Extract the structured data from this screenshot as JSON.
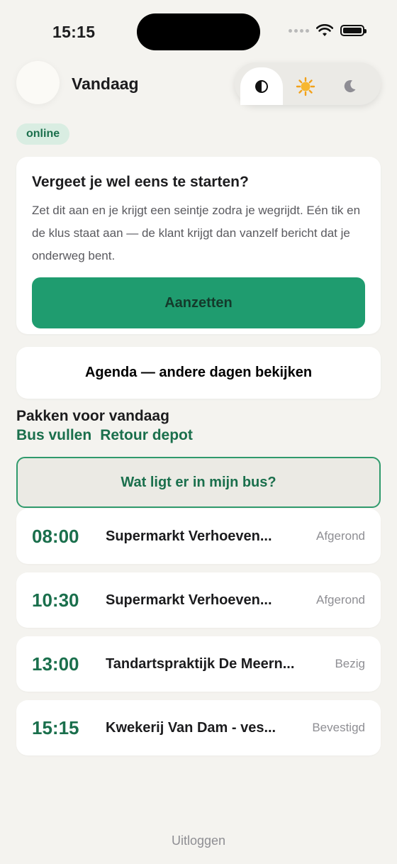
{
  "status_bar": {
    "time": "15:15"
  },
  "header": {
    "title": "Vandaag"
  },
  "theme_switch": {
    "options": [
      {
        "name": "auto",
        "icon": "contrast-icon",
        "glyph": "◐",
        "active": true
      },
      {
        "name": "light",
        "icon": "sun-icon",
        "glyph": "☀",
        "active": false
      },
      {
        "name": "dark",
        "icon": "moon-icon",
        "glyph": "☾",
        "active": false
      }
    ]
  },
  "connection": {
    "status": "online"
  },
  "start_card": {
    "title": "Vergeet je wel eens te starten?",
    "body": "Zet dit aan en je krijgt een seintje zodra je wegrijdt. Eén tik en de klus staat aan — de klant krijgt dan vanzelf bericht dat je onderweg bent.",
    "button_label": "Aanzetten"
  },
  "agenda": {
    "label": "Agenda — andere dagen bekijken"
  },
  "packing": {
    "title": "Pakken voor vandaag",
    "links": [
      "Bus vullen",
      "Retour depot"
    ],
    "bus_button_label": "Wat ligt er in mijn bus?"
  },
  "jobs": [
    {
      "time": "08:00",
      "name": "Supermarkt Verhoeven...",
      "status": "Afgerond"
    },
    {
      "time": "10:30",
      "name": "Supermarkt Verhoeven...",
      "status": "Afgerond"
    },
    {
      "time": "13:00",
      "name": "Tandartspraktijk De Meern...",
      "status": "Bezig"
    },
    {
      "time": "15:15",
      "name": "Kwekerij Van Dam - ves...",
      "status": "Bevestigd"
    }
  ],
  "footer": {
    "logout_label": "Uitloggen"
  },
  "colors": {
    "background": "#f4f3ef",
    "accent": "#1f9c6f",
    "accent_text": "#1a6f4c",
    "badge_bg": "#d9ede2",
    "muted": "#8e8e93"
  }
}
